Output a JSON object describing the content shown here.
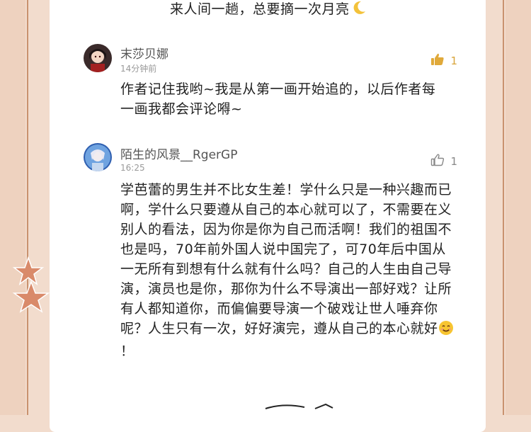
{
  "top_text": "来人间一趟，总要摘一次月亮",
  "comments": [
    {
      "username": "末莎贝娜",
      "time": "14分钟前",
      "likes": "1",
      "text": "作者记住我哟~我是从第一画开始追的，以后作者每一画我都会评论嘚~"
    },
    {
      "username": "陌生的风景__RgerGP",
      "time": "16:25",
      "likes": "1",
      "text": "学芭蕾的男生并不比女生差！学什么只是一种兴趣而已啊，学什么只要遵从自己的本心就可以了，不需要在义别人的看法，因为你是你为自己而活啊！我们的祖国不也是吗，70年前外国人说中国完了，可70年后中国从一无所有到想有什么就有什么吗？自己的人生由自己导演，演员也是你，那你为什么不导演出一部好戏？让所有人都知道你，而偏偏要导演一个破戏让世人唾弃你呢？人生只有一次，好好演完，遵从自己的本心就好",
      "text_end": "！"
    }
  ],
  "colors": {
    "background": "#f2dccd",
    "card": "#ffffff",
    "like_active": "#e0a93a",
    "like_inactive": "#888888",
    "star_accent": "#d98a6a"
  },
  "icons": [
    "moon-emoji-icon",
    "thumbs-up-filled-icon",
    "thumbs-up-outline-icon",
    "smile-emoji-icon",
    "star-decoration-icon"
  ]
}
